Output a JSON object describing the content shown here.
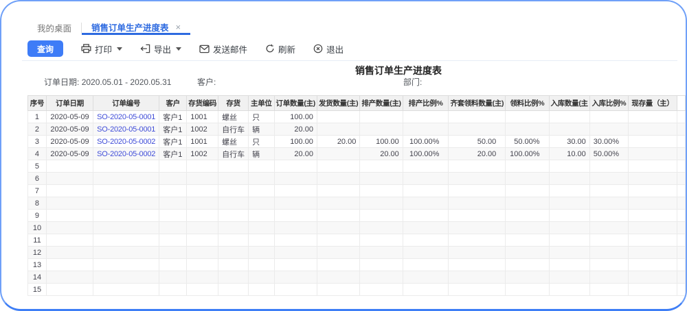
{
  "tabs": {
    "desktop": "我的桌面",
    "active": "销售订单生产进度表",
    "close": "×"
  },
  "toolbar": {
    "query": "查询",
    "print": "打印",
    "export": "导出",
    "send_mail": "发送邮件",
    "refresh": "刷新",
    "exit": "退出"
  },
  "report": {
    "title": "销售订单生产进度表",
    "filters": {
      "order_date_label": "订单日期:",
      "order_date_value": "2020.05.01 - 2020.05.31",
      "customer_label": "客户:",
      "department_label": "部门:"
    }
  },
  "table": {
    "columns": [
      "序号",
      "订单日期",
      "订单编号",
      "客户",
      "存货编码",
      "存货",
      "主单位",
      "订单数量(主)",
      "发货数量(主)",
      "排产数量(主)",
      "排产比例%",
      "齐套领料数量(主)",
      "领料比例%",
      "入库数量(主",
      "入库比例%",
      "现存量（主）",
      ""
    ],
    "rows": [
      [
        "1",
        "2020-05-09",
        "SO-2020-05-0001",
        "客户1",
        "1001",
        "螺丝",
        "只",
        "100.00",
        "",
        "",
        "",
        "",
        "",
        "",
        "",
        ""
      ],
      [
        "2",
        "2020-05-09",
        "SO-2020-05-0001",
        "客户1",
        "1002",
        "自行车",
        "辆",
        "20.00",
        "",
        "",
        "",
        "",
        "",
        "",
        "",
        ""
      ],
      [
        "3",
        "2020-05-09",
        "SO-2020-05-0002",
        "客户1",
        "1001",
        "螺丝",
        "只",
        "100.00",
        "20.00",
        "100.00",
        "100.00%",
        "50.00",
        "50.00%",
        "30.00",
        "30.00%",
        ""
      ],
      [
        "4",
        "2020-05-09",
        "SO-2020-05-0002",
        "客户1",
        "1002",
        "自行车",
        "辆",
        "20.00",
        "",
        "20.00",
        "100.00%",
        "20.00",
        "100.00%",
        "10.00",
        "50.00%",
        ""
      ],
      [
        "5",
        "",
        "",
        "",
        "",
        "",
        "",
        "",
        "",
        "",
        "",
        "",
        "",
        "",
        "",
        ""
      ],
      [
        "6",
        "",
        "",
        "",
        "",
        "",
        "",
        "",
        "",
        "",
        "",
        "",
        "",
        "",
        "",
        ""
      ],
      [
        "7",
        "",
        "",
        "",
        "",
        "",
        "",
        "",
        "",
        "",
        "",
        "",
        "",
        "",
        "",
        ""
      ],
      [
        "8",
        "",
        "",
        "",
        "",
        "",
        "",
        "",
        "",
        "",
        "",
        "",
        "",
        "",
        "",
        ""
      ],
      [
        "9",
        "",
        "",
        "",
        "",
        "",
        "",
        "",
        "",
        "",
        "",
        "",
        "",
        "",
        "",
        ""
      ],
      [
        "10",
        "",
        "",
        "",
        "",
        "",
        "",
        "",
        "",
        "",
        "",
        "",
        "",
        "",
        "",
        ""
      ],
      [
        "11",
        "",
        "",
        "",
        "",
        "",
        "",
        "",
        "",
        "",
        "",
        "",
        "",
        "",
        "",
        ""
      ],
      [
        "12",
        "",
        "",
        "",
        "",
        "",
        "",
        "",
        "",
        "",
        "",
        "",
        "",
        "",
        "",
        ""
      ],
      [
        "13",
        "",
        "",
        "",
        "",
        "",
        "",
        "",
        "",
        "",
        "",
        "",
        "",
        "",
        "",
        ""
      ],
      [
        "14",
        "",
        "",
        "",
        "",
        "",
        "",
        "",
        "",
        "",
        "",
        "",
        "",
        "",
        "",
        ""
      ],
      [
        "15",
        "",
        "",
        "",
        "",
        "",
        "",
        "",
        "",
        "",
        "",
        "",
        "",
        "",
        "",
        ""
      ]
    ],
    "accent_link_color": "#3f4cd8"
  }
}
